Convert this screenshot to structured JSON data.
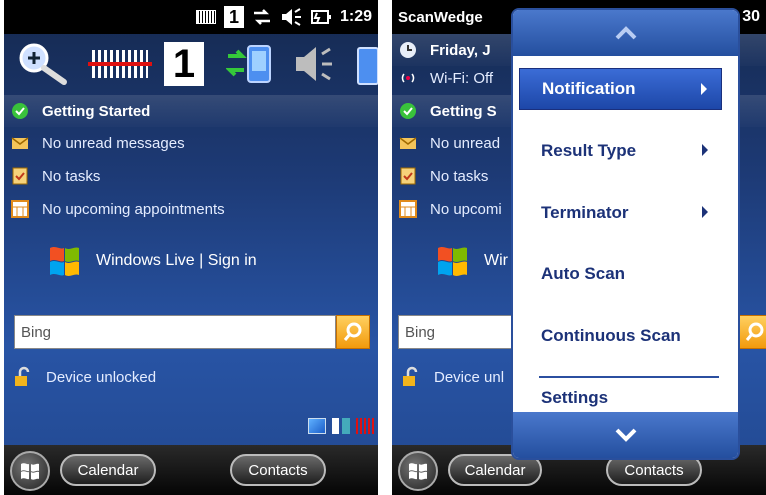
{
  "left": {
    "status": {
      "time": "1:29",
      "mini_number": "1"
    },
    "toolbar": {
      "big_number": "1"
    },
    "today": {
      "getting_started": "Getting Started",
      "messages": "No unread messages",
      "tasks": "No tasks",
      "appointments": "No upcoming appointments"
    },
    "live": "Windows Live | Sign in",
    "search": {
      "placeholder": "Bing"
    },
    "lock_status": "Device unlocked",
    "softkeys": {
      "left": "Calendar",
      "right": "Contacts"
    }
  },
  "right": {
    "status": {
      "app_title": "ScanWedge",
      "time": "30"
    },
    "today": {
      "date": "Friday, J",
      "wifi": "Wi-Fi: Off",
      "getting_started": "Getting S",
      "messages": "No unread",
      "tasks": "No tasks",
      "appointments": "No upcomi"
    },
    "live": "Wir",
    "search": {
      "placeholder": "Bing"
    },
    "lock_status": "Device unl",
    "softkeys": {
      "left": "Calendar",
      "right": "Contacts"
    },
    "menu": {
      "items": [
        {
          "label": "Notification",
          "submenu": true,
          "selected": true
        },
        {
          "label": "Result Type",
          "submenu": true
        },
        {
          "label": "Terminator",
          "submenu": true
        },
        {
          "label": "Auto Scan",
          "submenu": false
        },
        {
          "label": "Continuous Scan",
          "submenu": false
        },
        {
          "label": "Settings",
          "submenu": false
        }
      ]
    }
  },
  "colors": {
    "accent": "#1d47a8",
    "menu_text": "#1c3278",
    "search_button": "#f29a0c"
  }
}
